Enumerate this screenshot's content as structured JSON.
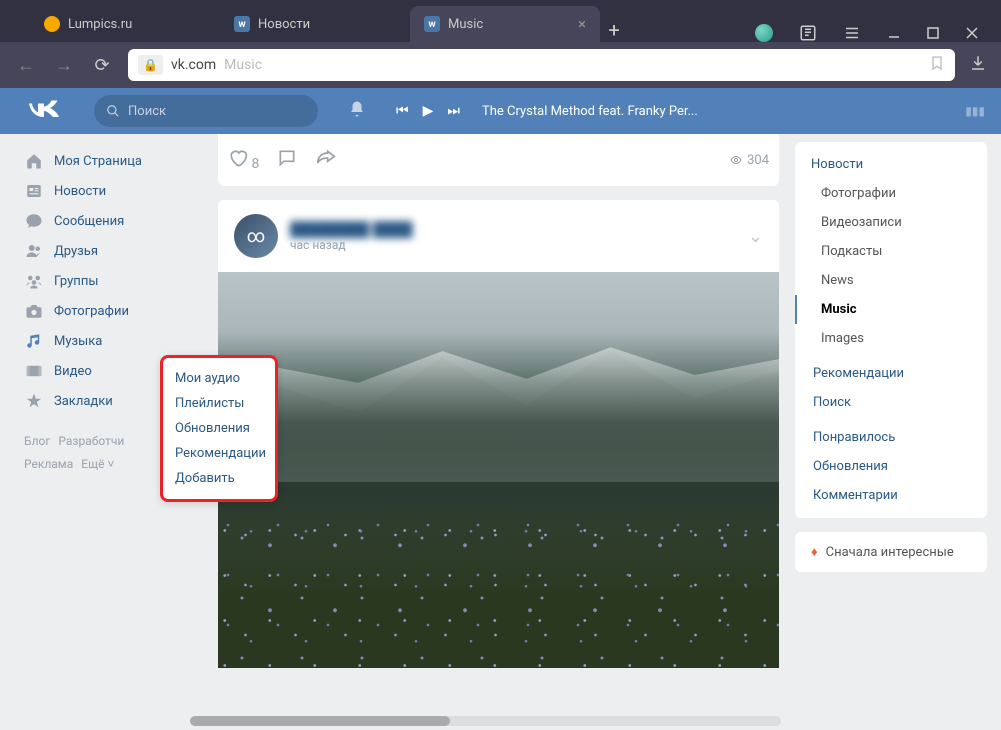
{
  "tabs": [
    {
      "label": "Lumpics.ru"
    },
    {
      "label": "Новости"
    },
    {
      "label": "Music"
    }
  ],
  "url": {
    "host": "vk.com",
    "path": "Music"
  },
  "vk_header": {
    "search_placeholder": "Поиск",
    "now_playing": "The Crystal Method feat. Franky Per..."
  },
  "left_nav": [
    {
      "icon": "home",
      "label": "Моя Страница"
    },
    {
      "icon": "news",
      "label": "Новости"
    },
    {
      "icon": "msg",
      "label": "Сообщения"
    },
    {
      "icon": "friends",
      "label": "Друзья"
    },
    {
      "icon": "groups",
      "label": "Группы"
    },
    {
      "icon": "photos",
      "label": "Фотографии"
    },
    {
      "icon": "music",
      "label": "Музыка",
      "active": true
    },
    {
      "icon": "video",
      "label": "Видео"
    },
    {
      "icon": "bookmarks",
      "label": "Закладки"
    }
  ],
  "footer_links": [
    "Блог",
    "Разработчи",
    "Реклама",
    "Ещё ˅"
  ],
  "music_popup": [
    "Мои аудио",
    "Плейлисты",
    "Обновления",
    "Рекомендации",
    "Добавить"
  ],
  "post_top": {
    "likes": "8",
    "views": "304"
  },
  "post": {
    "author": "████████ ████",
    "time": "час назад"
  },
  "right_nav": {
    "title": "Новости",
    "sub": [
      "Фотографии",
      "Видеозаписи",
      "Подкасты",
      "News"
    ],
    "active": "Music",
    "sub2": [
      "Images"
    ],
    "links1": [
      "Рекомендации",
      "Поиск"
    ],
    "links2": [
      "Понравилось",
      "Обновления",
      "Комментарии"
    ],
    "sort": "Сначала интересные"
  }
}
